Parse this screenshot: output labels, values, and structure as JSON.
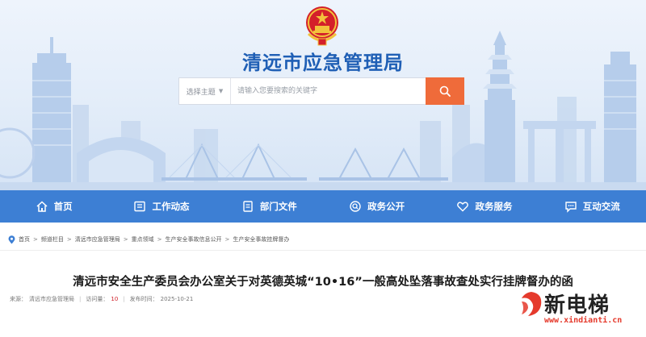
{
  "site": {
    "title": "清远市应急管理局"
  },
  "search": {
    "select_label": "选择主题",
    "placeholder": "请输入您要搜索的关键字"
  },
  "nav": {
    "items": [
      {
        "label": "首页",
        "icon": "home-icon"
      },
      {
        "label": "工作动态",
        "icon": "news-icon"
      },
      {
        "label": "部门文件",
        "icon": "folder-icon"
      },
      {
        "label": "政务公开",
        "icon": "magnifier-icon"
      },
      {
        "label": "政务服务",
        "icon": "heart-icon"
      },
      {
        "label": "互动交流",
        "icon": "chat-icon"
      }
    ]
  },
  "breadcrumb": {
    "items": [
      "首页",
      "频道栏目",
      "清远市应急管理局",
      "重点领域",
      "生产安全事故信息公开",
      "生产安全事故挂牌督办"
    ]
  },
  "article": {
    "title": "清远市安全生产委员会办公室关于对英德英城“10•16”一般高处坠落事故查处实行挂牌督办的函",
    "source_label": "来源：",
    "source": "清远市应急管理局",
    "views_label": "访问量：",
    "views": "10",
    "date_label": "发布时间：",
    "date": "2025-10-21"
  },
  "watermark": {
    "brand": "新电梯",
    "url": "www.xindianti.cn"
  },
  "colors": {
    "nav_bg": "#3d7fd4",
    "title_blue": "#1f5fb5",
    "search_button": "#ef6b3a",
    "views_red": "#d0202a"
  }
}
